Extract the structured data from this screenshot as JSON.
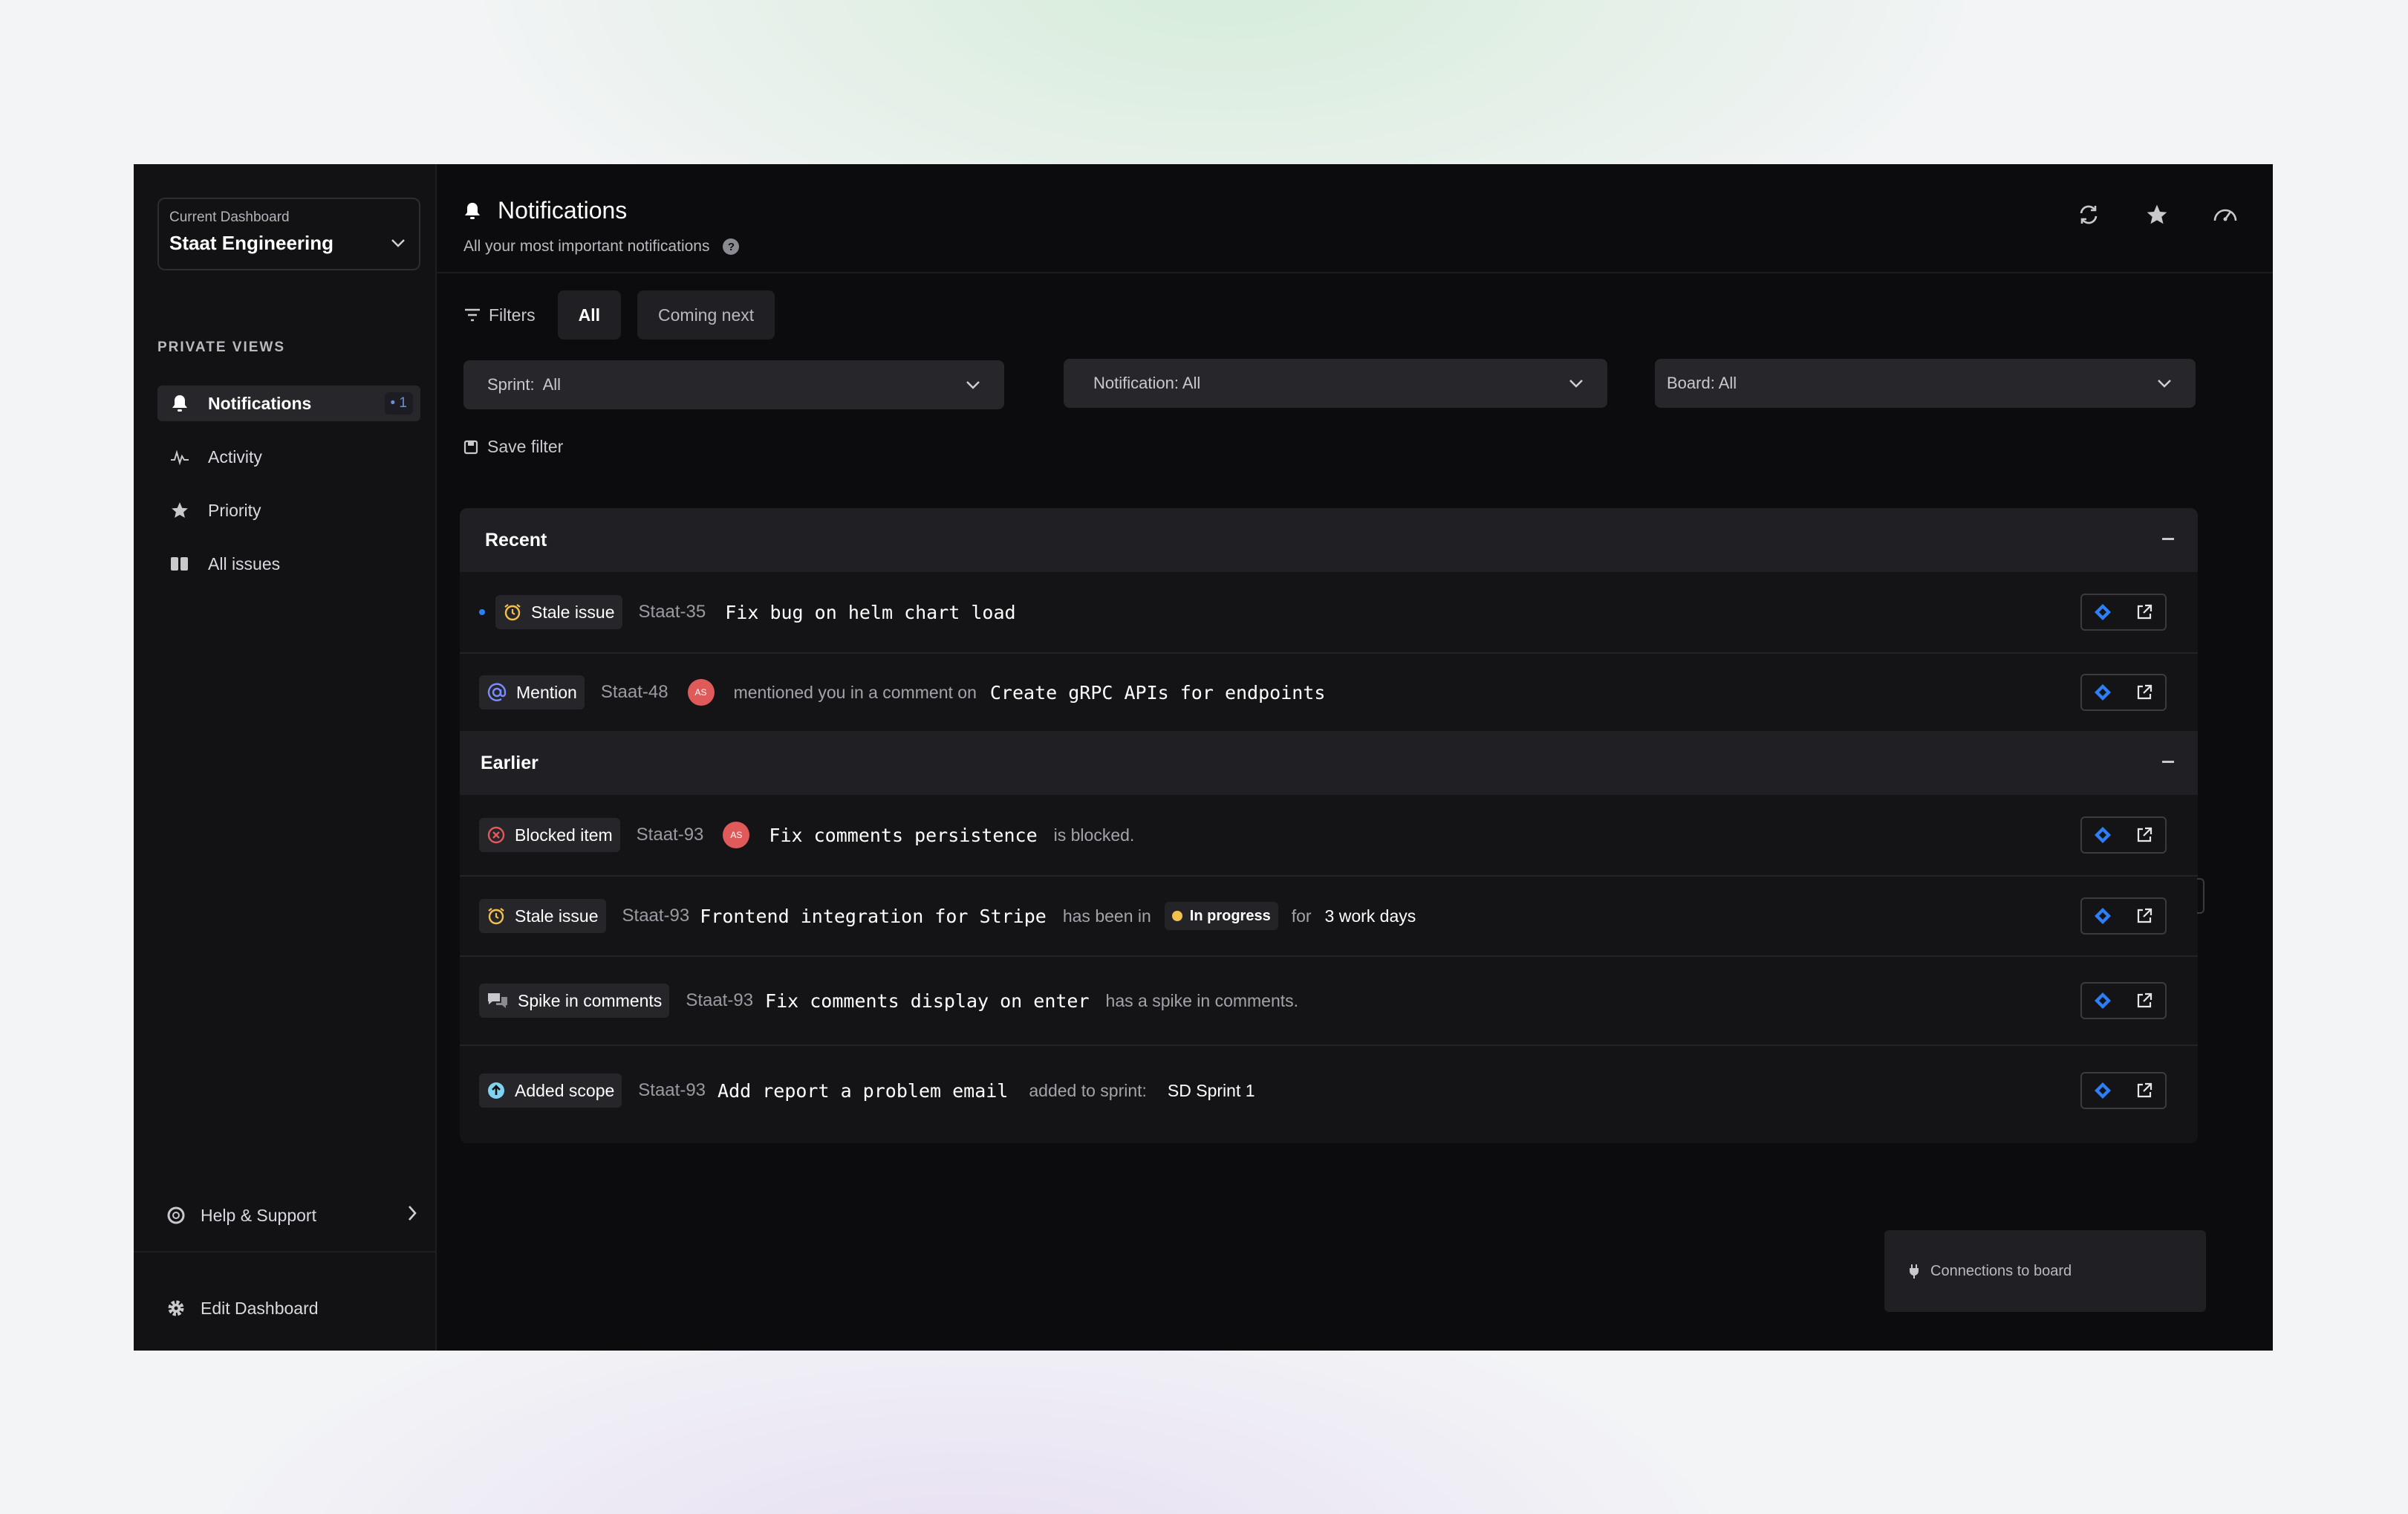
{
  "sidebar": {
    "dashboard_caption": "Current Dashboard",
    "dashboard_name": "Staat Engineering",
    "section_title": "PRIVATE VIEWS",
    "items": [
      {
        "label": "Notifications",
        "icon": "bell-icon",
        "badge": "• 1"
      },
      {
        "label": "Activity",
        "icon": "activity-icon"
      },
      {
        "label": "Priority",
        "icon": "star-icon"
      },
      {
        "label": "All issues",
        "icon": "columns-icon"
      }
    ],
    "help_label": "Help & Support",
    "edit_label": "Edit Dashboard"
  },
  "header": {
    "title": "Notifications",
    "subtitle": "All your most important notifications",
    "help_mark": "?",
    "actions": [
      "refresh-icon",
      "star-icon",
      "gauge-icon"
    ]
  },
  "filters": {
    "label": "Filters",
    "chips": [
      "All",
      "Coming next"
    ],
    "sprint": "Sprint:  All",
    "notification": "Notification: All",
    "board": "Board: All",
    "save_label": "Save filter"
  },
  "groups": {
    "recent": {
      "title": "Recent",
      "rows": [
        {
          "tag": "Stale issue",
          "key": "Staat-35",
          "title": "Fix bug on helm chart load",
          "unread": true
        },
        {
          "tag": "Mention",
          "key": "Staat-48",
          "avatar": "AS",
          "text": "mentioned you in a comment on",
          "title": "Create gRPC APIs for endpoints"
        }
      ]
    },
    "earlier": {
      "title": "Earlier",
      "rows": [
        {
          "tag": "Blocked item",
          "key": "Staat-93",
          "avatar": "AS",
          "title": "Fix comments persistence",
          "text": "is blocked."
        },
        {
          "tag": "Stale issue",
          "key": "Staat-93",
          "title": "Frontend integration for Stripe",
          "text": "has been in",
          "status": "In progress",
          "text2": "for",
          "duration": "3 work days"
        },
        {
          "tag": "Spike in comments",
          "key": "Staat-93",
          "title": "Fix comments display on enter",
          "text": "has a spike in comments."
        },
        {
          "tag": "Added scope",
          "key": "Staat-93",
          "title": "Add report a problem email",
          "text": "added to sprint:",
          "sprint": "SD Sprint 1"
        }
      ]
    }
  },
  "connections_label": "Connections to board",
  "colors": {
    "accent_blue": "#2d7ff9",
    "avatar_red": "#e05a5a",
    "status_yellow": "#f2c14b",
    "background": "#0c0c0e"
  }
}
